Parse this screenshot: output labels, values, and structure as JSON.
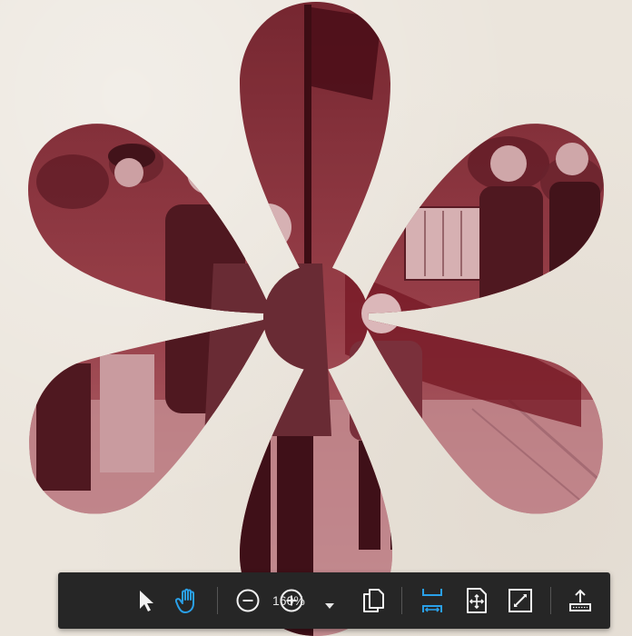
{
  "viewer": {
    "zoom_level": "160%",
    "active_tool": "hand"
  },
  "toolbar": {
    "buttons": [
      {
        "name": "select-tool",
        "icon": "pointer-arrow-icon",
        "active": false
      },
      {
        "name": "hand-tool",
        "icon": "hand-icon",
        "active": true
      },
      {
        "name": "zoom-out",
        "icon": "minus-circle-icon",
        "active": false
      },
      {
        "name": "zoom-in",
        "icon": "plus-circle-icon",
        "active": false
      },
      {
        "name": "copy",
        "icon": "copy-pages-icon",
        "active": false
      },
      {
        "name": "fit-width",
        "icon": "fit-width-icon",
        "active": true
      },
      {
        "name": "fit-page",
        "icon": "fit-page-icon",
        "active": false
      },
      {
        "name": "fullscreen",
        "icon": "fullscreen-icon",
        "active": false
      },
      {
        "name": "export",
        "icon": "upload-tray-icon",
        "active": false
      }
    ]
  },
  "colors": {
    "toolbar_bg": "#262626",
    "icon_default": "#f2f2f2",
    "icon_active": "#2aa0e8",
    "page_bg": "#ebe5dc",
    "photo_tint": "#a14650"
  }
}
